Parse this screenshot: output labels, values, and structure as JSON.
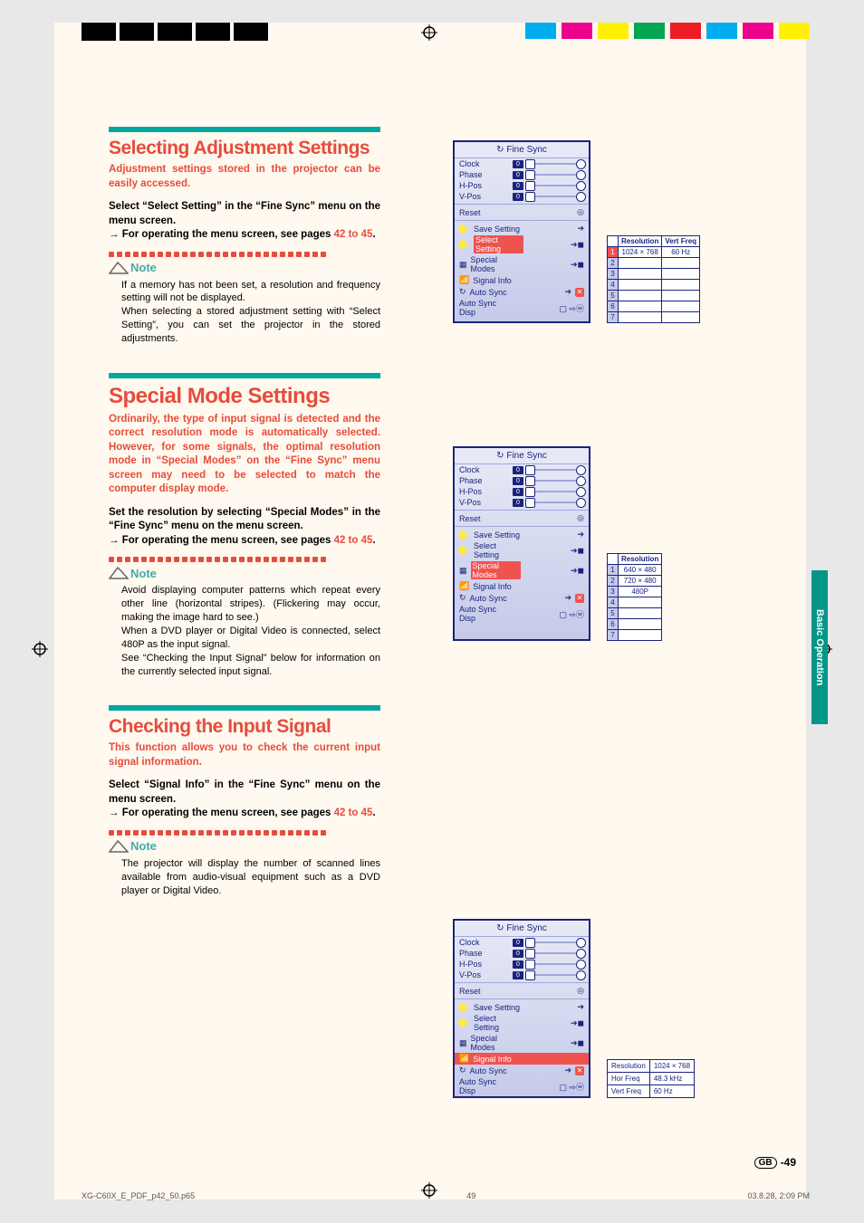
{
  "side_tab": "Basic Operation",
  "page_number": "-49",
  "page_locale": "GB",
  "doc_footer": {
    "file": "XG-C60X_E_PDF_p42_50.p65",
    "page": "49",
    "date": "03.8.28, 2:09 PM"
  },
  "note_label": "Note",
  "pages_ref": "42 to 45",
  "section1": {
    "title": "Selecting Adjustment Settings",
    "intro": "Adjustment settings stored in the projector can be easily accessed.",
    "body1": "Select “Select Setting” in the “Fine Sync” menu on the menu screen.",
    "body2_prefix": "→ For operating the menu screen, see pages ",
    "body2_suffix": ".",
    "note_a": "If a memory has not been set, a resolution and frequency setting will not be displayed.",
    "note_b": "When selecting a stored adjustment setting with “Select Setting”, you can set the projector in the stored adjustments."
  },
  "section2": {
    "title": "Special Mode Settings",
    "intro": "Ordinarily, the type of input signal is detected and the correct resolution mode is automatically selected. However, for some signals, the optimal resolution mode in “Special Modes” on the “Fine Sync” menu screen may need to be selected to match the computer display mode.",
    "body1": "Set the resolution by selecting “Special Modes” in the “Fine Sync” menu on the menu screen.",
    "body2_prefix": "→ For operating the menu screen, see pages ",
    "body2_suffix": ".",
    "note_a": "Avoid displaying computer patterns which repeat every other line (horizontal stripes). (Flickering may occur, making the image hard to see.)",
    "note_b": "When a DVD player or Digital Video is connected, select 480P as the input signal.",
    "note_c": "See “Checking the Input Signal” below for information on the currently selected input signal."
  },
  "section3": {
    "title": "Checking the Input Signal",
    "intro": "This function allows you to check the current input signal information.",
    "body1": "Select “Signal Info” in the “Fine Sync” menu on the menu screen.",
    "body2_prefix": "→ For operating the menu screen, see pages ",
    "body2_suffix": ".",
    "note_a": "The projector will display the number of scanned lines available from audio-visual equipment such as a DVD player or Digital Video."
  },
  "osd": {
    "title": "Fine Sync",
    "clock": "Clock",
    "phase": "Phase",
    "hpos": "H-Pos",
    "vpos": "V-Pos",
    "reset": "Reset",
    "save": "Save Setting",
    "select": "Select Setting",
    "special": "Special Modes",
    "signal": "Signal Info",
    "auto": "Auto Sync",
    "disp": "Auto Sync Disp",
    "zero": "0"
  },
  "table1": {
    "h1": "Resolution",
    "h2": "Vert Freq",
    "r1c1": "1024 × 768",
    "r1c2": "60 Hz"
  },
  "table2": {
    "h1": "Resolution",
    "r1": "640 × 480",
    "r2": "720 × 480",
    "r3": "480P"
  },
  "table3": {
    "r1a": "Resolution",
    "r1b": "1024 × 768",
    "r2a": "Hor Freq",
    "r2b": "48.3 kHz",
    "r3a": "Vert Freq",
    "r3b": "60 Hz"
  }
}
